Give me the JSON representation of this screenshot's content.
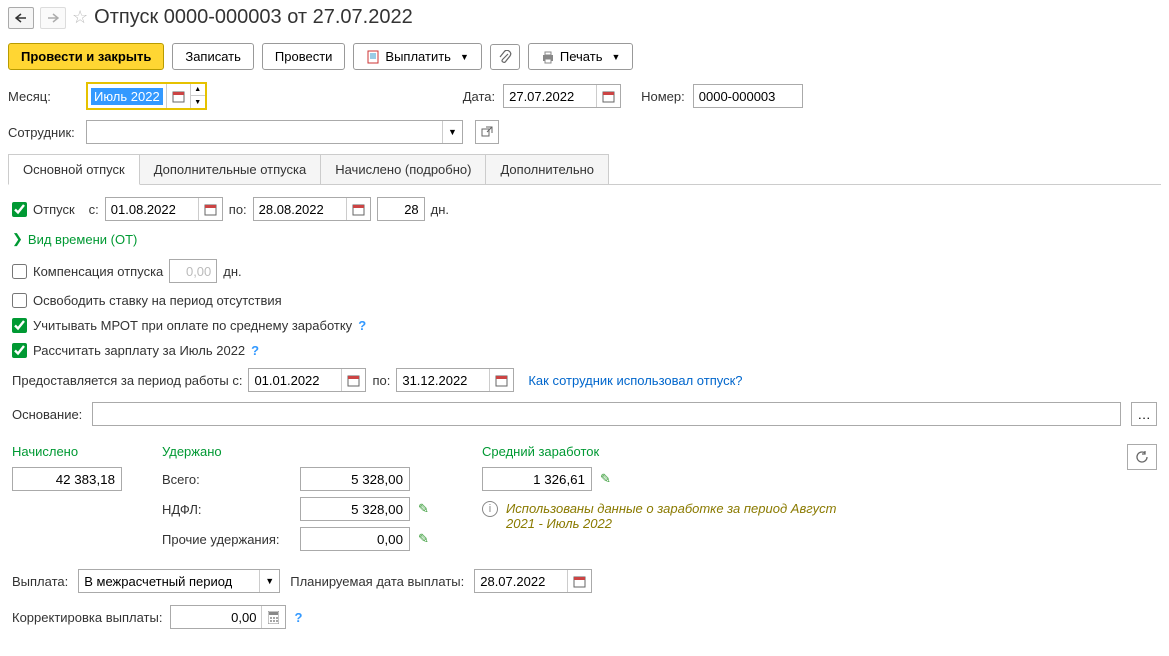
{
  "header": {
    "title": "Отпуск 0000-000003 от 27.07.2022"
  },
  "toolbar": {
    "post_close": "Провести и закрыть",
    "write": "Записать",
    "post": "Провести",
    "pay": "Выплатить",
    "print": "Печать"
  },
  "fields": {
    "month_label": "Месяц:",
    "month_value": "Июль 2022",
    "date_label": "Дата:",
    "date_value": "27.07.2022",
    "number_label": "Номер:",
    "number_value": "0000-000003",
    "employee_label": "Сотрудник:",
    "employee_value": ""
  },
  "tabs": [
    "Основной отпуск",
    "Дополнительные отпуска",
    "Начислено (подробно)",
    "Дополнительно"
  ],
  "vacation": {
    "checkbox_label": "Отпуск",
    "from_label": "с:",
    "from_value": "01.08.2022",
    "to_label": "по:",
    "to_value": "28.08.2022",
    "days_value": "28",
    "days_unit": "дн.",
    "time_type": "Вид времени (ОТ)",
    "compensation_label": "Компенсация отпуска",
    "compensation_value": "0,00",
    "compensation_unit": "дн.",
    "release_rate": "Освободить ставку на период отсутствия",
    "mrot": "Учитывать МРОТ при оплате по среднему заработку",
    "calc_salary": "Рассчитать зарплату за Июль 2022",
    "period_label": "Предоставляется за период работы с:",
    "period_from": "01.01.2022",
    "period_to_label": "по:",
    "period_to": "31.12.2022",
    "usage_link": "Как сотрудник использовал отпуск?",
    "reason_label": "Основание:"
  },
  "totals": {
    "accrued_label": "Начислено",
    "accrued_value": "42 383,18",
    "deducted_label": "Удержано",
    "total_label": "Всего:",
    "total_value": "5 328,00",
    "ndfl_label": "НДФЛ:",
    "ndfl_value": "5 328,00",
    "other_label": "Прочие удержания:",
    "other_value": "0,00",
    "avg_label": "Средний заработок",
    "avg_value": "1 326,61",
    "info_text": "Использованы данные о заработке за период Август 2021 - Июль 2022"
  },
  "payment": {
    "label": "Выплата:",
    "value": "В межрасчетный период",
    "planned_label": "Планируемая дата выплаты:",
    "planned_value": "28.07.2022",
    "correction_label": "Корректировка выплаты:",
    "correction_value": "0,00"
  }
}
